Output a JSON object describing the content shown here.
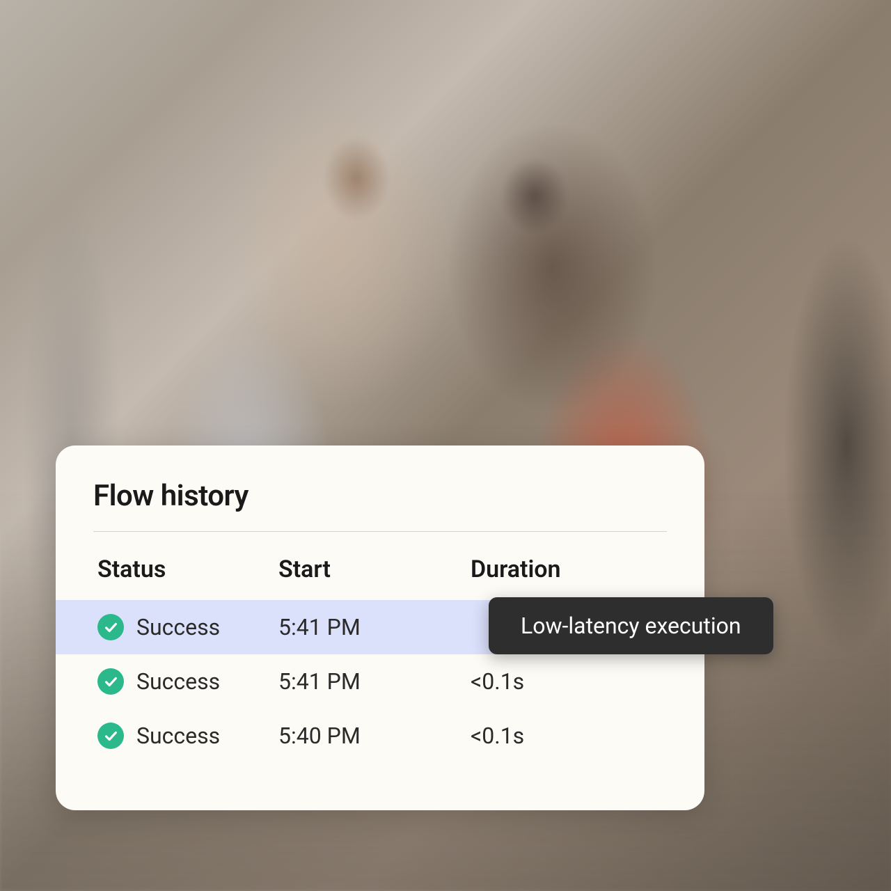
{
  "card": {
    "title": "Flow history",
    "columns": {
      "status": "Status",
      "start": "Start",
      "duration": "Duration"
    },
    "rows": [
      {
        "status": "Success",
        "start": "5:41 PM",
        "duration": "",
        "highlighted": true
      },
      {
        "status": "Success",
        "start": "5:41 PM",
        "duration": "<0.1s",
        "highlighted": false
      },
      {
        "status": "Success",
        "start": "5:40 PM",
        "duration": "<0.1s",
        "highlighted": false
      }
    ]
  },
  "tooltip": {
    "text": "Low-latency execution"
  }
}
